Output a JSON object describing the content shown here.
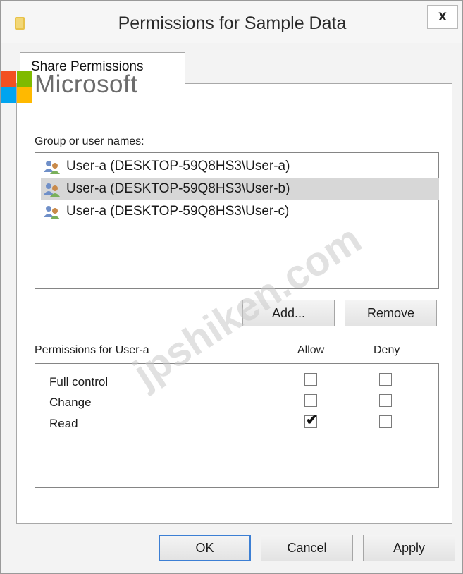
{
  "window": {
    "title": "Permissions for Sample Data",
    "close_label": "x"
  },
  "tabs": [
    {
      "label": "Share Permissions",
      "active": true
    }
  ],
  "logo": {
    "text": "Microsoft",
    "colors": [
      "#f25022",
      "#7fba00",
      "#00a4ef",
      "#ffb900"
    ]
  },
  "group_section": {
    "label": "Group or user names:",
    "users": [
      {
        "name": "User-a (DESKTOP-59Q8HS3\\User-a)",
        "icon": "users-group-icon",
        "selected": false
      },
      {
        "name": "User-a (DESKTOP-59Q8HS3\\User-b)",
        "icon": "users-group-icon",
        "selected": true
      },
      {
        "name": "User-a (DESKTOP-59Q8HS3\\User-c)",
        "icon": "users-group-icon",
        "selected": false
      }
    ],
    "add_label": "Add...",
    "remove_label": "Remove"
  },
  "permissions": {
    "label": "Permissions for User-a",
    "allow_header": "Allow",
    "deny_header": "Deny",
    "rows": [
      {
        "name": "Full control",
        "allow": false,
        "deny": false
      },
      {
        "name": "Change",
        "allow": false,
        "deny": false
      },
      {
        "name": "Read",
        "allow": true,
        "deny": false
      }
    ]
  },
  "footer": {
    "ok_label": "OK",
    "cancel_label": "Cancel",
    "apply_label": "Apply"
  },
  "watermark": "jpshiken.com"
}
